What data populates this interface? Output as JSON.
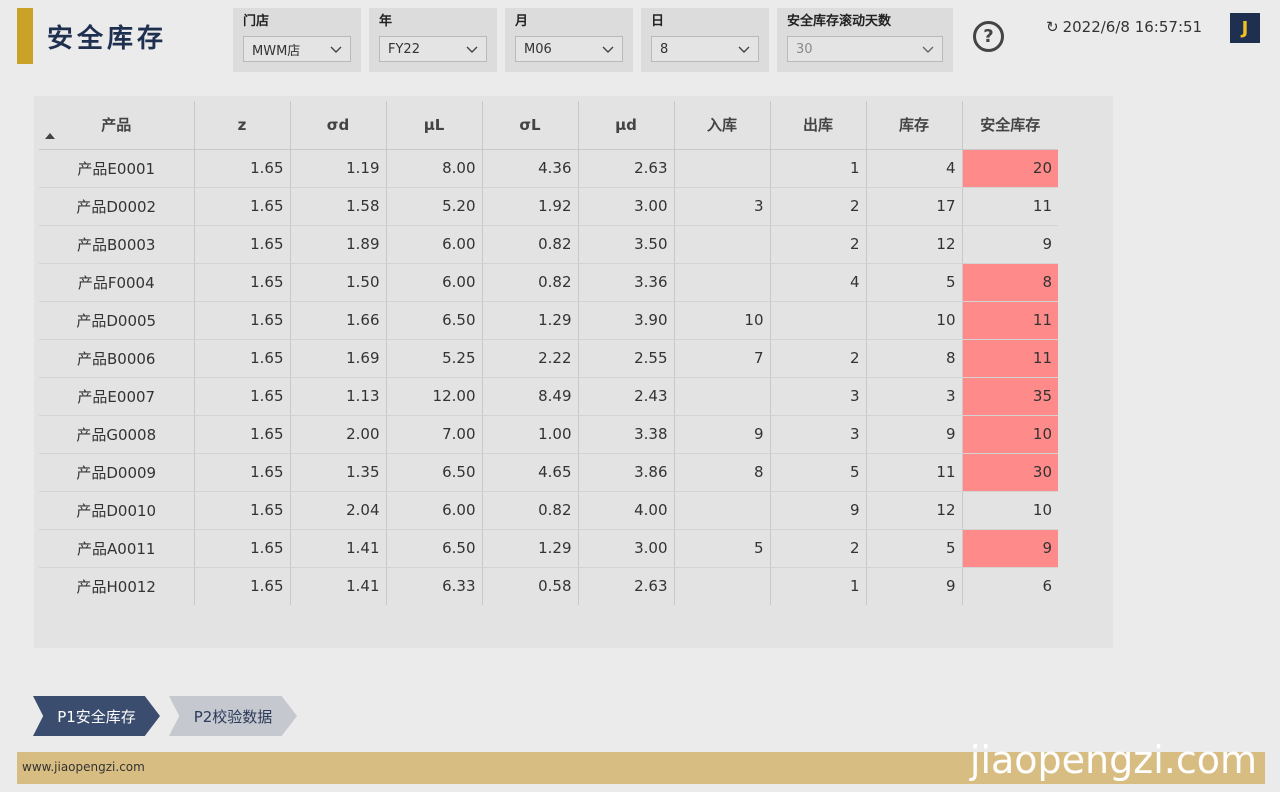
{
  "title": "安全库存",
  "slicers": [
    {
      "label": "门店",
      "value": "MWM店",
      "disabled": false
    },
    {
      "label": "年",
      "value": "FY22",
      "disabled": false
    },
    {
      "label": "月",
      "value": "M06",
      "disabled": false
    },
    {
      "label": "日",
      "value": "8",
      "disabled": false
    },
    {
      "label": "安全库存滚动天数",
      "value": "30",
      "disabled": true
    }
  ],
  "refresh_icon": "↻",
  "refresh_time": "2022/6/8 16:57:51",
  "logo_letter": "J",
  "help_symbol": "?",
  "table": {
    "columns": [
      "产品",
      "z",
      "σd",
      "μL",
      "σL",
      "μd",
      "入库",
      "出库",
      "库存",
      "安全库存"
    ],
    "alert_color": "#ff8a8a",
    "rows": [
      {
        "cells": [
          "产品E0001",
          "1.65",
          "1.19",
          "8.00",
          "4.36",
          "2.63",
          "",
          "1",
          "4",
          "20"
        ],
        "alert": true
      },
      {
        "cells": [
          "产品D0002",
          "1.65",
          "1.58",
          "5.20",
          "1.92",
          "3.00",
          "3",
          "2",
          "17",
          "11"
        ],
        "alert": false
      },
      {
        "cells": [
          "产品B0003",
          "1.65",
          "1.89",
          "6.00",
          "0.82",
          "3.50",
          "",
          "2",
          "12",
          "9"
        ],
        "alert": false
      },
      {
        "cells": [
          "产品F0004",
          "1.65",
          "1.50",
          "6.00",
          "0.82",
          "3.36",
          "",
          "4",
          "5",
          "8"
        ],
        "alert": true
      },
      {
        "cells": [
          "产品D0005",
          "1.65",
          "1.66",
          "6.50",
          "1.29",
          "3.90",
          "10",
          "",
          "10",
          "11"
        ],
        "alert": true
      },
      {
        "cells": [
          "产品B0006",
          "1.65",
          "1.69",
          "5.25",
          "2.22",
          "2.55",
          "7",
          "2",
          "8",
          "11"
        ],
        "alert": true
      },
      {
        "cells": [
          "产品E0007",
          "1.65",
          "1.13",
          "12.00",
          "8.49",
          "2.43",
          "",
          "3",
          "3",
          "35"
        ],
        "alert": true
      },
      {
        "cells": [
          "产品G0008",
          "1.65",
          "2.00",
          "7.00",
          "1.00",
          "3.38",
          "9",
          "3",
          "9",
          "10"
        ],
        "alert": true
      },
      {
        "cells": [
          "产品D0009",
          "1.65",
          "1.35",
          "6.50",
          "4.65",
          "3.86",
          "8",
          "5",
          "11",
          "30"
        ],
        "alert": true
      },
      {
        "cells": [
          "产品D0010",
          "1.65",
          "2.04",
          "6.00",
          "0.82",
          "4.00",
          "",
          "9",
          "12",
          "10"
        ],
        "alert": false
      },
      {
        "cells": [
          "产品A0011",
          "1.65",
          "1.41",
          "6.50",
          "1.29",
          "3.00",
          "5",
          "2",
          "5",
          "9"
        ],
        "alert": true
      },
      {
        "cells": [
          "产品H0012",
          "1.65",
          "1.41",
          "6.33",
          "0.58",
          "2.63",
          "",
          "1",
          "9",
          "6"
        ],
        "alert": false
      }
    ]
  },
  "pages": [
    {
      "label": "P1安全库存",
      "active": true
    },
    {
      "label": "P2校验数据",
      "active": false
    }
  ],
  "footer_url": "www.jiaopengzi.com",
  "watermark": "jiaopengzi.com",
  "colors": {
    "accent": "#c9a227",
    "navy": "#1f2f4f",
    "footer": "#d8bd82"
  }
}
